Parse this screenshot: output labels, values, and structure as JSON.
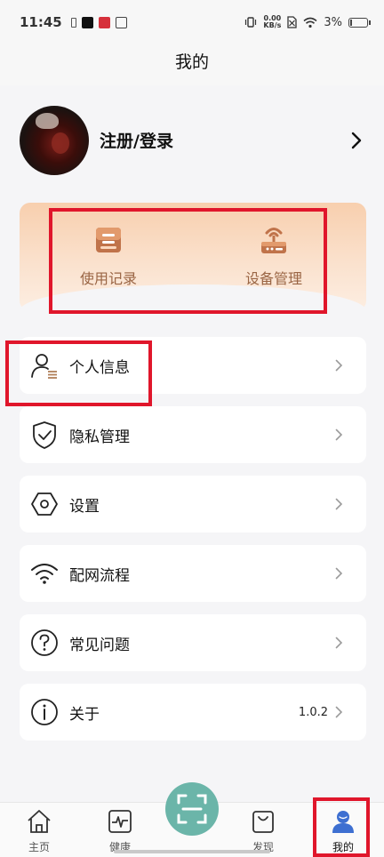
{
  "status_bar": {
    "time": "11:45",
    "net_speed_value": "0.00",
    "net_speed_unit": "KB/s",
    "battery": "3%"
  },
  "header": {
    "title": "我的"
  },
  "profile": {
    "login_label": "注册/登录"
  },
  "quick_actions": [
    {
      "label": "使用记录",
      "icon": "record-icon"
    },
    {
      "label": "设备管理",
      "icon": "router-icon"
    }
  ],
  "menu": [
    {
      "label": "个人信息",
      "icon": "person-list-icon"
    },
    {
      "label": "隐私管理",
      "icon": "shield-check-icon"
    },
    {
      "label": "设置",
      "icon": "hexagon-settings-icon"
    },
    {
      "label": "配网流程",
      "icon": "wifi-icon"
    },
    {
      "label": "常见问题",
      "icon": "question-icon"
    },
    {
      "label": "关于",
      "icon": "info-icon",
      "value": "1.0.2"
    }
  ],
  "bottom_nav": [
    {
      "label": "主页",
      "icon": "home-icon"
    },
    {
      "label": "健康",
      "icon": "heart-rate-icon"
    },
    {
      "label": "发现",
      "icon": "bag-icon"
    },
    {
      "label": "我的",
      "icon": "user-icon",
      "active": true
    }
  ],
  "colors": {
    "accent_teal": "#6bb5a9",
    "highlight_red": "#e0162b",
    "card_orange": "#f8cfae",
    "icon_brown": "#c0734a",
    "active_blue": "#3d6fd1"
  }
}
